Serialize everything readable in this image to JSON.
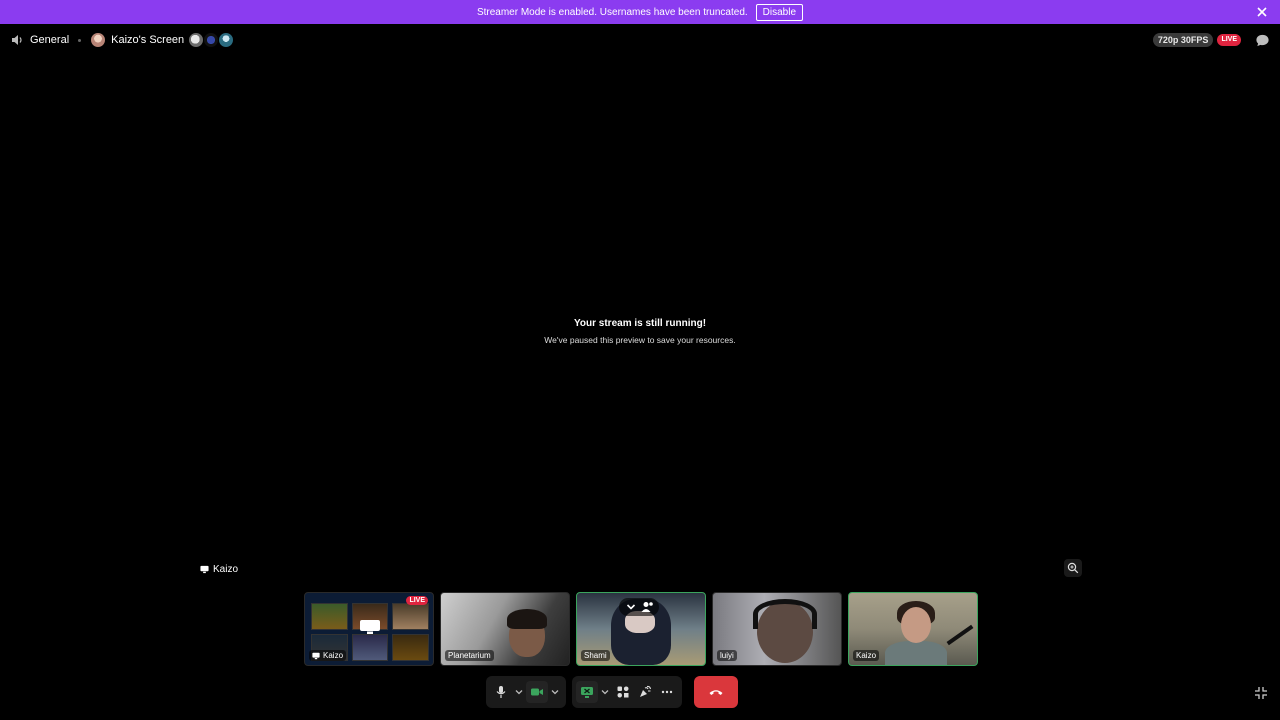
{
  "banner": {
    "message": "Streamer Mode is enabled. Usernames have been truncated.",
    "disable_label": "Disable",
    "close_icon": "close-icon"
  },
  "topbar": {
    "channel_name": "General",
    "stream_title": "Kaizo's Screen",
    "quality": "720p 30FPS",
    "live_label": "LIVE"
  },
  "stream": {
    "paused_title": "Your stream is still running!",
    "paused_subtitle": "We've paused this preview to save your resources.",
    "streamer_label": "Kaizo"
  },
  "tiles": [
    {
      "name": "Kaizo",
      "type": "screen",
      "live_label": "LIVE"
    },
    {
      "name": "Planetarium",
      "type": "camera"
    },
    {
      "name": "Shami",
      "type": "camera"
    },
    {
      "name": "luiyi",
      "type": "camera"
    },
    {
      "name": "Kaizo",
      "type": "camera"
    }
  ],
  "colors": {
    "banner": "#8b3cf0",
    "live": "#e0243f",
    "speaking": "#3ba55d",
    "hangup": "#da373c"
  }
}
